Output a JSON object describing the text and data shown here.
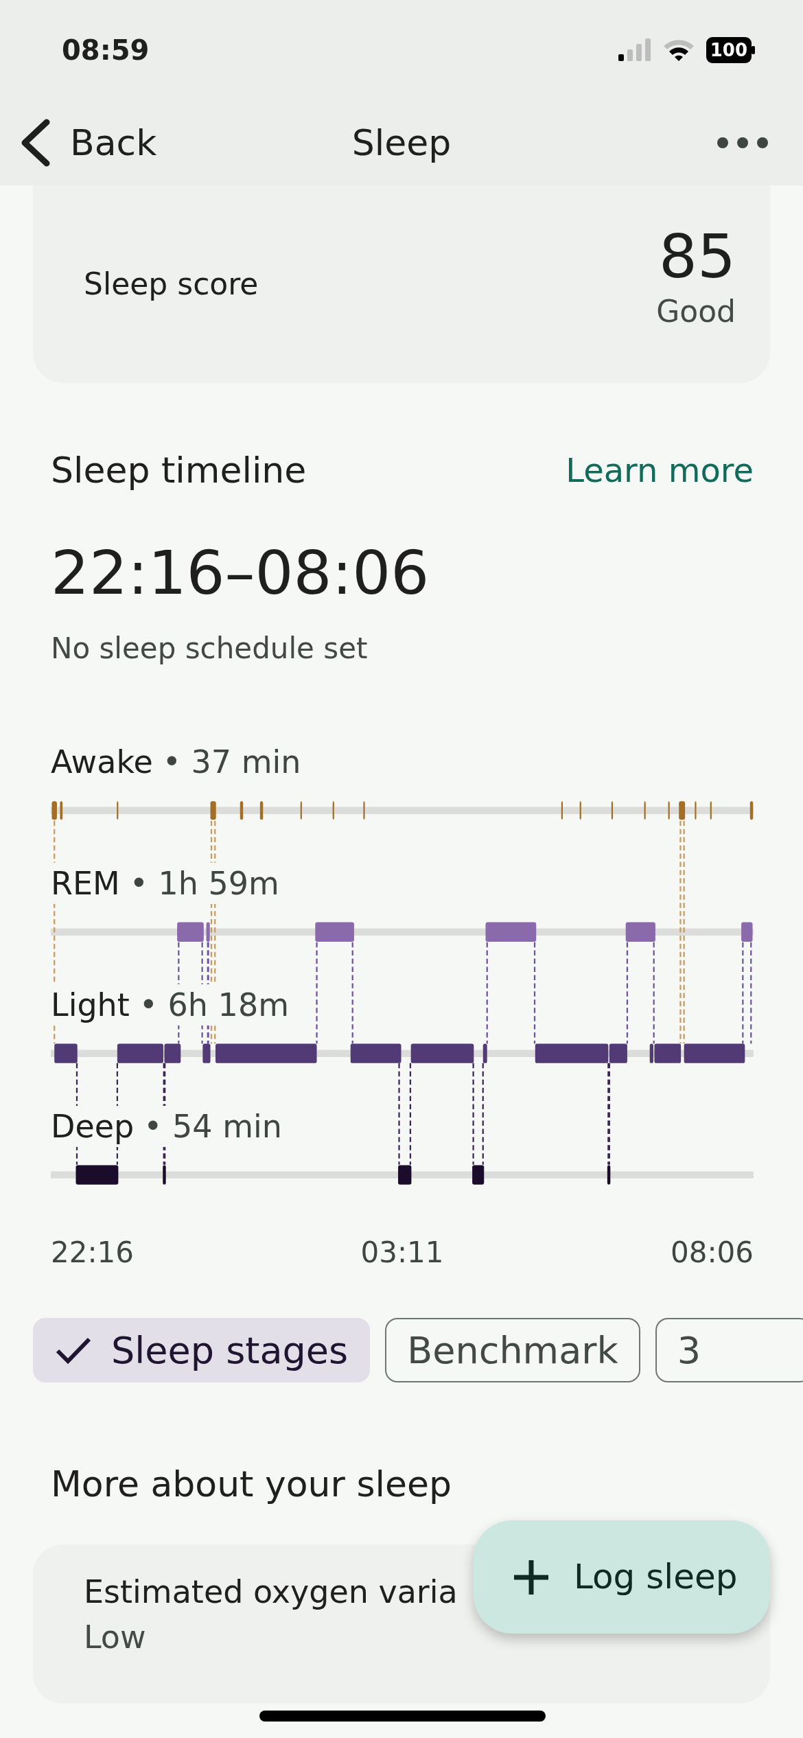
{
  "status_bar": {
    "time": "08:59",
    "battery": "100"
  },
  "nav": {
    "back": "Back",
    "title": "Sleep"
  },
  "score_card": {
    "label": "Sleep score",
    "score": "85",
    "rating": "Good"
  },
  "timeline": {
    "title": "Sleep timeline",
    "link": "Learn more",
    "range": "22:16–08:06",
    "schedule": "No sleep schedule set",
    "stages": [
      {
        "name": "Awake",
        "detail": "• 37 min"
      },
      {
        "name": "REM",
        "detail": "• 1h 59m"
      },
      {
        "name": "Light",
        "detail": "• 6h 18m"
      },
      {
        "name": "Deep",
        "detail": "• 54 min"
      }
    ],
    "axis": [
      "22:16",
      "03:11",
      "08:06"
    ]
  },
  "chips": [
    {
      "label": "Sleep stages",
      "selected": true
    },
    {
      "label": "Benchmark",
      "selected": false
    },
    {
      "label": "3",
      "selected": false
    }
  ],
  "more": {
    "title": "More about your sleep",
    "cards": [
      {
        "title": "Estimated oxygen varia",
        "value": "Low"
      }
    ]
  },
  "fab": {
    "label": "Log sleep"
  }
}
